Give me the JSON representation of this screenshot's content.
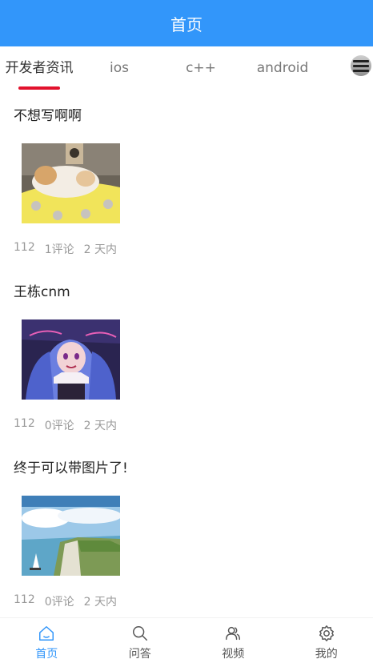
{
  "navbar": {
    "title": "首页"
  },
  "channels": {
    "items": [
      {
        "label": "开发者资讯",
        "active": true
      },
      {
        "label": "ios"
      },
      {
        "label": "c++"
      },
      {
        "label": "android"
      }
    ],
    "menu_icon": "hamburger-menu-icon"
  },
  "articles": [
    {
      "title": "不想写啊啊",
      "views": "112",
      "comments": "1评论",
      "time": "2 天内",
      "image": "sleeping-cat-photo"
    },
    {
      "title": "王栋cnm",
      "views": "112",
      "comments": "0评论",
      "time": "2 天内",
      "image": "anime-girl-illustration"
    },
    {
      "title": "终于可以带图片了!",
      "views": "112",
      "comments": "0评论",
      "time": "2 天内",
      "image": "coastal-cliff-landscape"
    }
  ],
  "tabbar": {
    "items": [
      {
        "label": "首页",
        "icon": "home-icon",
        "active": true
      },
      {
        "label": "问答",
        "icon": "search-icon"
      },
      {
        "label": "视频",
        "icon": "users-icon"
      },
      {
        "label": "我的",
        "icon": "gear-icon"
      }
    ]
  },
  "colors": {
    "primary": "#3296fa",
    "accent": "#e2122d"
  }
}
